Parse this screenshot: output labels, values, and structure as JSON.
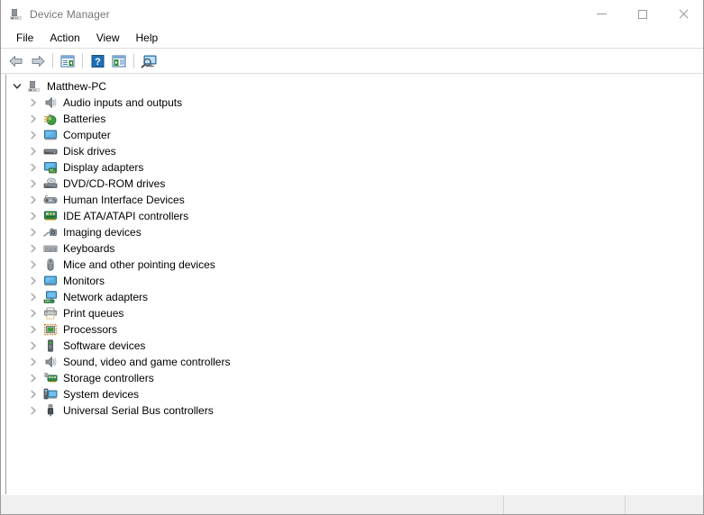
{
  "window": {
    "title": "Device Manager",
    "title_icon": "computer-tower-icon",
    "controls": {
      "minimize": "minimize-button",
      "maximize": "maximize-button",
      "close": "close-button"
    }
  },
  "menubar": {
    "items": [
      {
        "label": "File",
        "name": "menu-file"
      },
      {
        "label": "Action",
        "name": "menu-action"
      },
      {
        "label": "View",
        "name": "menu-view"
      },
      {
        "label": "Help",
        "name": "menu-help"
      }
    ]
  },
  "toolbar": {
    "items": [
      {
        "name": "back-button",
        "icon": "back-arrow-icon",
        "type": "button"
      },
      {
        "name": "forward-button",
        "icon": "forward-arrow-icon",
        "type": "button"
      },
      {
        "name": "toolbar-separator-1",
        "icon": "separator",
        "type": "separator"
      },
      {
        "name": "properties-button",
        "icon": "properties-icon",
        "type": "button"
      },
      {
        "name": "toolbar-separator-2",
        "icon": "separator",
        "type": "separator"
      },
      {
        "name": "help-button",
        "icon": "help-question-icon",
        "type": "button"
      },
      {
        "name": "update-driver-button",
        "icon": "update-driver-icon",
        "type": "button"
      },
      {
        "name": "toolbar-separator-3",
        "icon": "separator",
        "type": "separator"
      },
      {
        "name": "scan-hardware-changes-button",
        "icon": "scan-monitor-icon",
        "type": "button"
      }
    ]
  },
  "tree": {
    "root": {
      "label": "Matthew-PC",
      "icon": "computer-tower-icon",
      "expanded": true
    },
    "items": [
      {
        "label": "Audio inputs and outputs",
        "icon": "speaker-icon"
      },
      {
        "label": "Batteries",
        "icon": "battery-icon"
      },
      {
        "label": "Computer",
        "icon": "monitor-icon"
      },
      {
        "label": "Disk drives",
        "icon": "disk-drive-icon"
      },
      {
        "label": "Display adapters",
        "icon": "display-adapter-icon"
      },
      {
        "label": "DVD/CD-ROM drives",
        "icon": "optical-drive-icon"
      },
      {
        "label": "Human Interface Devices",
        "icon": "hid-icon"
      },
      {
        "label": "IDE ATA/ATAPI controllers",
        "icon": "ide-controller-icon"
      },
      {
        "label": "Imaging devices",
        "icon": "camera-icon"
      },
      {
        "label": "Keyboards",
        "icon": "keyboard-icon"
      },
      {
        "label": "Mice and other pointing devices",
        "icon": "mouse-icon"
      },
      {
        "label": "Monitors",
        "icon": "monitor-icon"
      },
      {
        "label": "Network adapters",
        "icon": "network-adapter-icon"
      },
      {
        "label": "Print queues",
        "icon": "printer-icon"
      },
      {
        "label": "Processors",
        "icon": "processor-chip-icon"
      },
      {
        "label": "Software devices",
        "icon": "software-device-icon"
      },
      {
        "label": "Sound, video and game controllers",
        "icon": "speaker-icon"
      },
      {
        "label": "Storage controllers",
        "icon": "storage-controller-icon"
      },
      {
        "label": "System devices",
        "icon": "system-device-icon"
      },
      {
        "label": "Universal Serial Bus controllers",
        "icon": "usb-icon"
      }
    ]
  },
  "statusbar": {
    "panels": [
      {
        "text": "",
        "name": "status-panel-main"
      },
      {
        "text": "",
        "name": "status-panel-secondary"
      },
      {
        "text": "",
        "name": "status-panel-tertiary"
      }
    ]
  },
  "colors": {
    "title_text": "#767676",
    "window_bg": "#ffffff",
    "statusbar_bg": "#f0f0f0",
    "accent_blue": "#1e90d2",
    "chevron_gray": "#9a9a9a"
  }
}
